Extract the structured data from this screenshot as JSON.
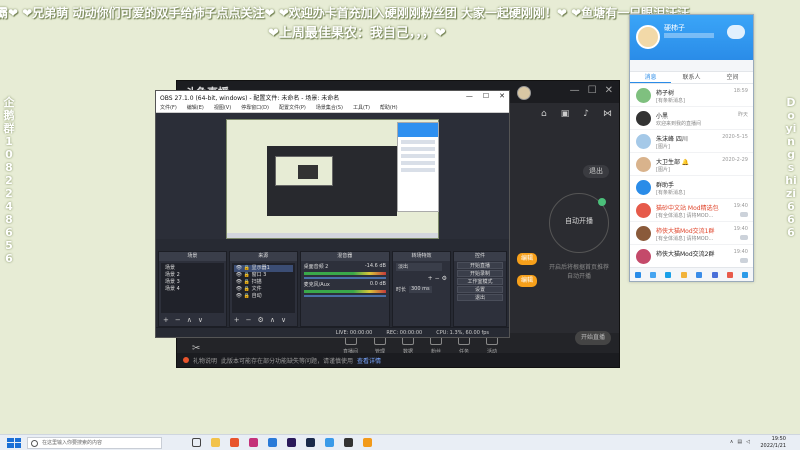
{
  "danmaku": {
    "line1": "霸❤ ❤兄弟萌 动动你们可爱的双手给柿子点点关注❤ ❤欢迎办卡首充加入硬刚刚粉丝团 大家一起硬刚刚！❤ ❤鱼塘有一只眼泪汪汪",
    "line2": "❤上周最佳果农：我自己，，，❤",
    "left_vertical": "企鹅群1082248656",
    "right_vertical": "Doyingshizi666"
  },
  "stream_app": {
    "title": "斗鱼直播",
    "exit_label": "退出",
    "auto_scene_label": "自动开播",
    "hint_text": "开启后将根据首页推荐自动开播",
    "orange_btn_label": "编辑",
    "bottom_items": [
      "直播间",
      "管理",
      "数据",
      "粉丝",
      "任务",
      "活动"
    ],
    "start_live_label": "开始直播",
    "status_text": "礼物说明",
    "status_detail": "此版本可能存在部分功能缺失等问题，请谨慎使用",
    "status_link": "查看详情"
  },
  "obs": {
    "title": "OBS 27.1.0 (64-bit, windows) - 配置文件: 未命名 - 场景: 未命名",
    "menu": [
      "文件(F)",
      "编辑(E)",
      "视图(V)",
      "停靠窗口(D)",
      "配置文件(P)",
      "场景集合(S)",
      "工具(T)",
      "帮助(H)"
    ],
    "docks": {
      "scenes_title": "场景",
      "scenes": [
        "场景",
        "场景 2",
        "场景 3",
        "场景 4"
      ],
      "sources_title": "来源",
      "sources": [
        "显示器1",
        "窗口 3",
        "扫描",
        "文件",
        "自动"
      ],
      "mixer_title": "混音器",
      "mixer_rows": [
        {
          "label": "桌面音频 2",
          "db": "-14.6 dB"
        },
        {
          "label": "麦克风/Aux",
          "db": "0.0 dB"
        }
      ],
      "transitions_title": "转场特效",
      "transition_value": "淡出",
      "duration_label": "时长",
      "duration_value": "300 ms",
      "controls_title": "控件",
      "controls": [
        "开始直播",
        "开始录制",
        "工作室模式",
        "设置",
        "退出"
      ]
    },
    "status": {
      "live": "LIVE: 00:00:00",
      "rec": "REC: 00:00:00",
      "cpu": "CPU: 1.3%, 60.00 fps"
    }
  },
  "qq": {
    "username": "硬柿子",
    "tabs": [
      "消息",
      "联系人",
      "空间"
    ],
    "contacts": [
      {
        "name": "柿子树",
        "msg": "[有条新消息]",
        "time": "18:59",
        "color": "#7fc07f",
        "red": false
      },
      {
        "name": "小黑",
        "msg": "欢迎来到我的直播间",
        "time": "昨天",
        "color": "#333333",
        "red": false
      },
      {
        "name": "朱沫峰 四川",
        "msg": "[图片]",
        "time": "2020-5-15",
        "color": "#a5c9e8",
        "red": false
      },
      {
        "name": "大卫生部 🔔",
        "msg": "[图片]",
        "time": "2020-2-29",
        "color": "#d9b38c",
        "red": false
      },
      {
        "name": "群助手",
        "msg": "[有条新消息]",
        "time": "",
        "color": "#2a8ce8",
        "red": false
      },
      {
        "name": "猫砂中文站 Mod精选包",
        "msg": "[有全体消息] 请将MOD...",
        "time": "19:40",
        "color": "#e65a4a",
        "red": true
      },
      {
        "name": "柿侠大猫Mod交流1群",
        "msg": "[有全体消息] 请将MOD...",
        "time": "19:40",
        "color": "#8a5a3a",
        "red": true
      },
      {
        "name": "柿侠大猫Mod交流2群",
        "msg": "",
        "time": "19:40",
        "color": "#c44a6a",
        "red": false
      }
    ],
    "bottom_icons": [
      "menu-icon",
      "person-icon",
      "qq-icon",
      "folder-icon",
      "mail-icon",
      "game-icon",
      "store-icon",
      "apps-icon"
    ]
  },
  "taskbar": {
    "search_placeholder": "在这里输入你要搜索的内容",
    "time": "19:50",
    "date": "2022/1/21"
  }
}
